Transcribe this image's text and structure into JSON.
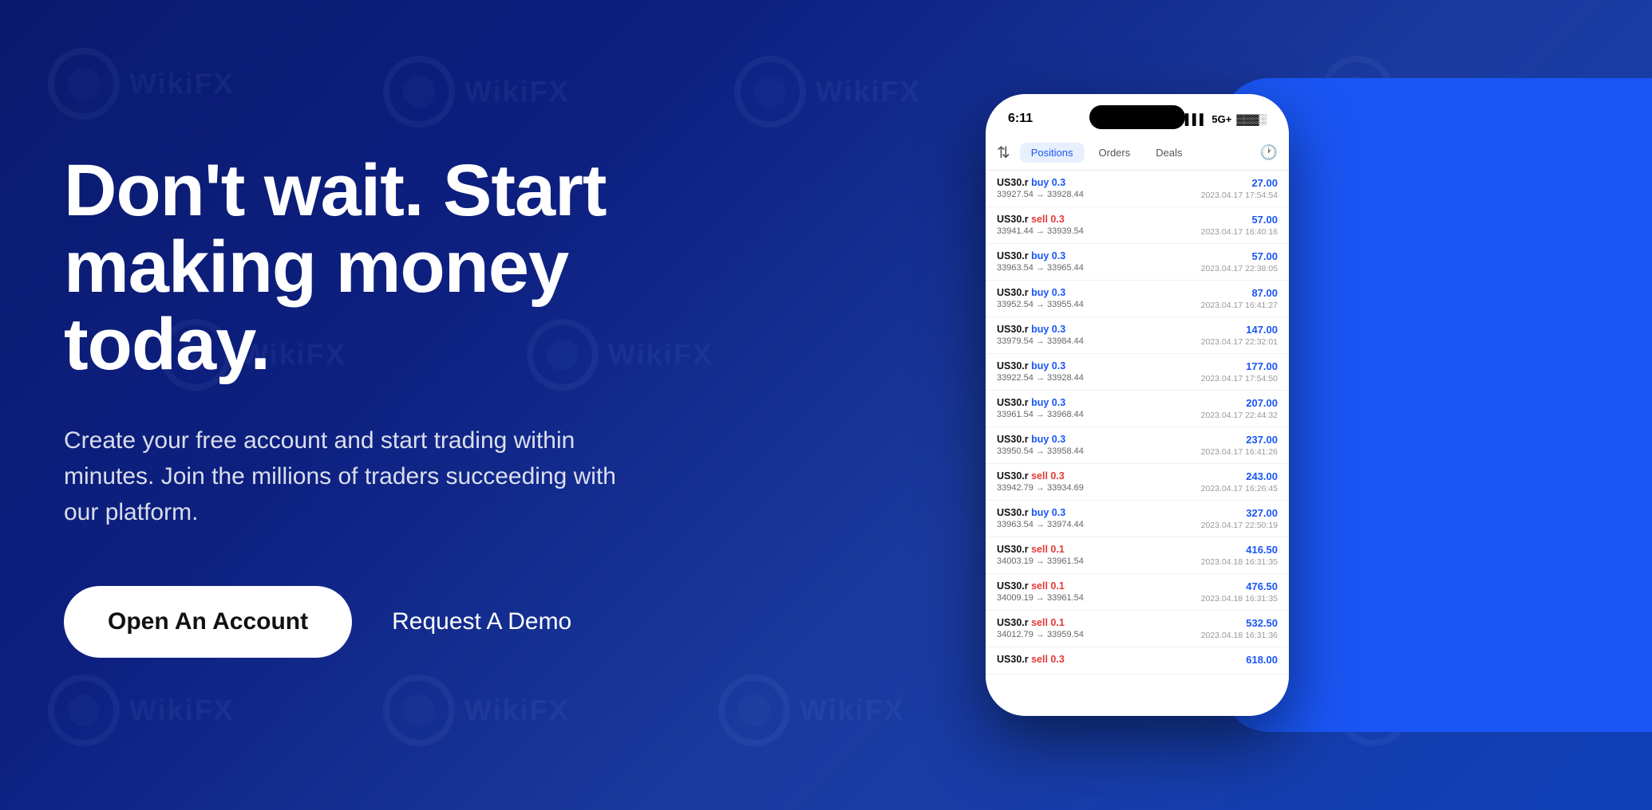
{
  "hero": {
    "headline_line1": "Don't wait. Start",
    "headline_line2": "making money today.",
    "subtitle": "Create your free account and start trading within minutes. Join the millions of traders succeeding with our platform.",
    "cta_primary": "Open An Account",
    "cta_secondary": "Request A Demo"
  },
  "phone": {
    "status_time": "6:11",
    "status_signal": "5G+",
    "tabs": [
      {
        "label": "Positions",
        "active": true
      },
      {
        "label": "Orders",
        "active": false
      },
      {
        "label": "Deals",
        "active": false
      }
    ],
    "trades": [
      {
        "instrument": "US30.r",
        "action": "buy",
        "qty": "0.3",
        "from": "33927.54",
        "to": "33928.44",
        "profit": "27.00",
        "time": "2023.04.17 17:54:54"
      },
      {
        "instrument": "US30.r",
        "action": "sell",
        "qty": "0.3",
        "from": "33941.44",
        "to": "33939.54",
        "profit": "57.00",
        "time": "2023.04.17 16:40:16"
      },
      {
        "instrument": "US30.r",
        "action": "buy",
        "qty": "0.3",
        "from": "33963.54",
        "to": "33965.44",
        "profit": "57.00",
        "time": "2023.04.17 22:38:05"
      },
      {
        "instrument": "US30.r",
        "action": "buy",
        "qty": "0.3",
        "from": "33952.54",
        "to": "33955.44",
        "profit": "87.00",
        "time": "2023.04.17 16:41:27"
      },
      {
        "instrument": "US30.r",
        "action": "buy",
        "qty": "0.3",
        "from": "33979.54",
        "to": "33984.44",
        "profit": "147.00",
        "time": "2023.04.17 22:32:01"
      },
      {
        "instrument": "US30.r",
        "action": "buy",
        "qty": "0.3",
        "from": "33922.54",
        "to": "33928.44",
        "profit": "177.00",
        "time": "2023.04.17 17:54:50"
      },
      {
        "instrument": "US30.r",
        "action": "buy",
        "qty": "0.3",
        "from": "33961.54",
        "to": "33968.44",
        "profit": "207.00",
        "time": "2023.04.17 22:44:32"
      },
      {
        "instrument": "US30.r",
        "action": "buy",
        "qty": "0.3",
        "from": "33950.54",
        "to": "33958.44",
        "profit": "237.00",
        "time": "2023.04.17 16:41:26"
      },
      {
        "instrument": "US30.r",
        "action": "sell",
        "qty": "0.3",
        "from": "33942.79",
        "to": "33934.69",
        "profit": "243.00",
        "time": "2023.04.17 16:26:45"
      },
      {
        "instrument": "US30.r",
        "action": "buy",
        "qty": "0.3",
        "from": "33963.54",
        "to": "33974.44",
        "profit": "327.00",
        "time": "2023.04.17 22:50:19"
      },
      {
        "instrument": "US30.r",
        "action": "sell",
        "qty": "0.1",
        "from": "34003.19",
        "to": "33961.54",
        "profit": "416.50",
        "time": "2023.04.18 16:31:35"
      },
      {
        "instrument": "US30.r",
        "action": "sell",
        "qty": "0.1",
        "from": "34009.19",
        "to": "33961.54",
        "profit": "476.50",
        "time": "2023.04.18 16:31:35"
      },
      {
        "instrument": "US30.r",
        "action": "sell",
        "qty": "0.1",
        "from": "34012.79",
        "to": "33959.54",
        "profit": "532.50",
        "time": "2023.04.18 16:31:36"
      },
      {
        "instrument": "US30.r",
        "action": "sell",
        "qty": "0.3",
        "from": "",
        "to": "",
        "profit": "618.00",
        "time": ""
      }
    ]
  },
  "watermark": {
    "text": "WikiFX"
  }
}
